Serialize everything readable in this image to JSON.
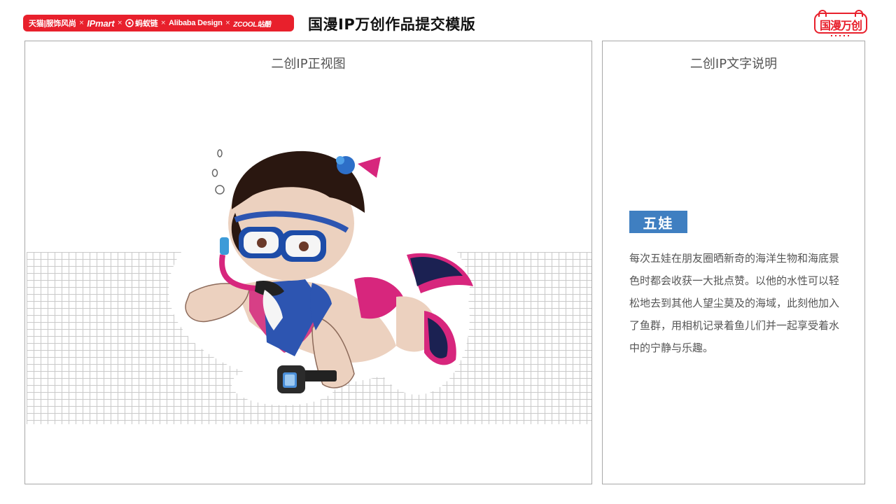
{
  "header": {
    "sponsors": [
      "天猫|服饰风尚",
      "IPmart",
      "蚂蚁链",
      "Alibaba Design",
      "ZCOOL站酷"
    ],
    "separator": "×",
    "template_title": "国漫IP万创作品提交模版",
    "brand_logo_text": "国漫万创",
    "colors": {
      "brand_red": "#e8202c"
    }
  },
  "front_view_panel": {
    "title": "二创IP正视图",
    "image": "five-baby-diver-illustration"
  },
  "description_panel": {
    "title": "二创IP文字说明",
    "character_name": "五娃",
    "description": "每次五娃在朋友圈晒新奇的海洋生物和海底景色时都会收获一大批点赞。以他的水性可以轻松地去到其他人望尘莫及的海域，此刻他加入了鱼群，用相机记录着鱼儿们并一起享受着水中的宁静与乐趣。",
    "colors": {
      "badge": "#3f7fc1"
    }
  }
}
